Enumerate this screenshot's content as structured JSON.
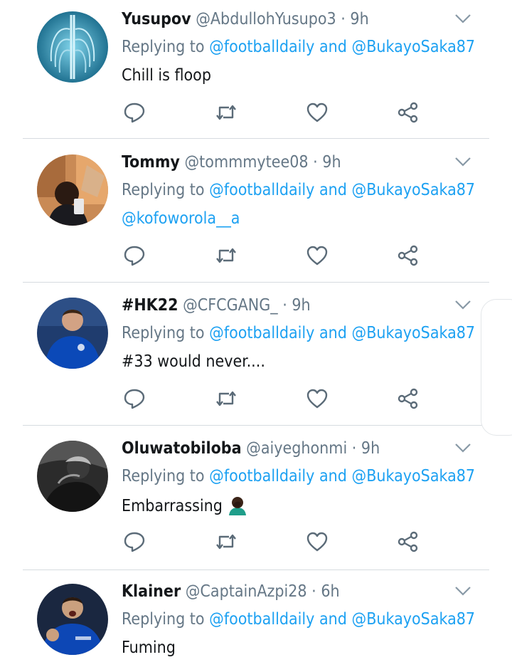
{
  "colors": {
    "link": "#1da1f2",
    "muted": "#657786",
    "name": "#14171a",
    "divider": "#d6dbe0"
  },
  "tweets": [
    {
      "name": "Yusupov",
      "handle": "@AbdullohYusupo3",
      "time": "9h",
      "reply_prefix": "Replying to",
      "reply_to_1": "@footballdaily",
      "reply_and": "and",
      "reply_to_2": "@BukayoSaka87",
      "text": "Chill is floop",
      "text_mention": "",
      "avatar": "xray-avatar"
    },
    {
      "name": "Tommy",
      "handle": "@tommmytee08",
      "time": "9h",
      "reply_prefix": "Replying to",
      "reply_to_1": "@footballdaily",
      "reply_and": "and",
      "reply_to_2": "@BukayoSaka87",
      "text": "",
      "text_mention": "@kofoworola__a",
      "avatar": "selfie-avatar"
    },
    {
      "name": "#HK22",
      "handle": "@CFCGANG_",
      "time": "9h",
      "reply_prefix": "Replying to",
      "reply_to_1": "@footballdaily",
      "reply_and": "and",
      "reply_to_2": "@BukayoSaka87",
      "text": "#33 would never....",
      "text_mention": "",
      "avatar": "player-avatar"
    },
    {
      "name": "Oluwatobiloba",
      "handle": "@aiyeghonmi",
      "time": "9h",
      "reply_prefix": "Replying to",
      "reply_to_1": "@footballdaily",
      "reply_and": "and",
      "reply_to_2": "@BukayoSaka87",
      "text": "Embarrassing",
      "text_mention": "",
      "emoji": "facepalm-emoji",
      "avatar": "bw-avatar"
    },
    {
      "name": "Klainer",
      "handle": "@CaptainAzpi28",
      "time": "6h",
      "reply_prefix": "Replying to",
      "reply_to_1": "@footballdaily",
      "reply_and": "and",
      "reply_to_2": "@BukayoSaka87",
      "text": "Fuming",
      "text_mention": "",
      "avatar": "celebration-avatar"
    }
  ],
  "icons": {
    "reply": "reply-icon",
    "retweet": "retweet-icon",
    "like": "like-icon",
    "share": "share-icon",
    "more": "chevron-down-icon"
  }
}
